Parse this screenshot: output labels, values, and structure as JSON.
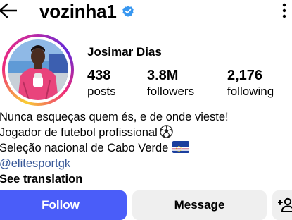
{
  "header": {
    "username": "vozinha1",
    "back_icon": "arrow-left-icon",
    "verified_icon": "verified-badge-icon",
    "more_icon": "more-vertical-icon",
    "verified_color": "#3897f0"
  },
  "profile": {
    "display_name": "Josimar Dias",
    "avatar": "profile-photo-goalkeeper"
  },
  "stats": {
    "posts": {
      "value": "438",
      "label": "posts"
    },
    "followers": {
      "value": "3.8M",
      "label": "followers"
    },
    "following": {
      "value": "2,176",
      "label": "following"
    }
  },
  "bio": {
    "line1": "Nunca esqueças quem és, e de onde vieste!",
    "line2": "Jogador de futebol profissional",
    "line2_emoji": "soccer-ball-icon",
    "line3": "Seleção nacional de Cabo Verde",
    "line3_emoji": "cape-verde-flag-icon",
    "link": "@elitesportgk",
    "see_translation": "See translation"
  },
  "actions": {
    "follow": "Follow",
    "message": "Message",
    "add_user_icon": "add-user-icon",
    "follow_color": "#4a5df9"
  }
}
